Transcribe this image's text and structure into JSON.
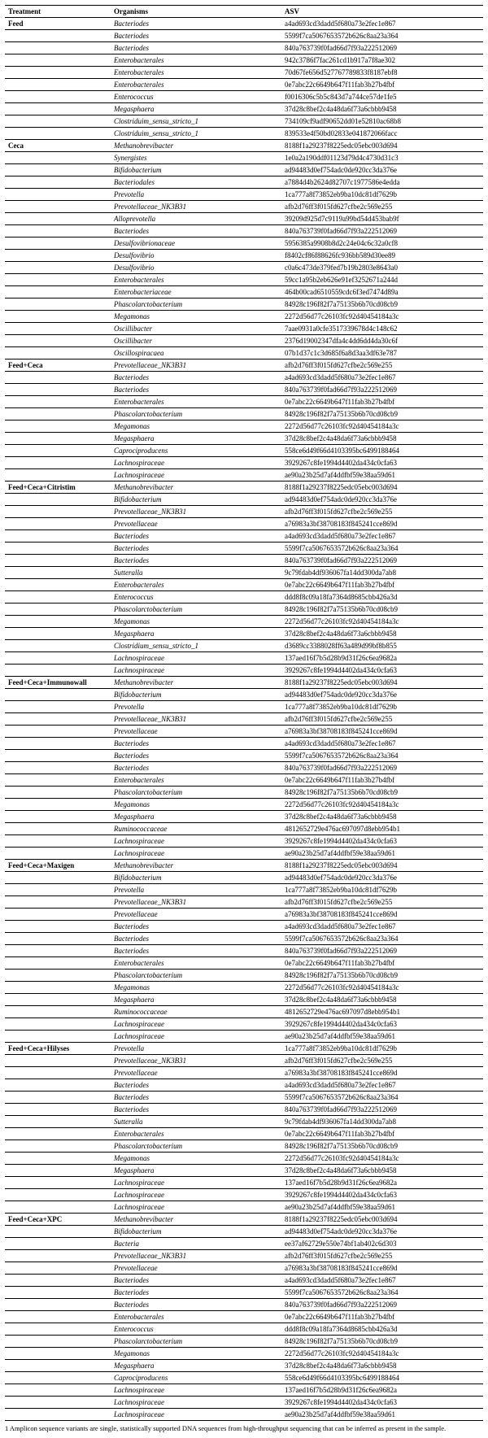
{
  "footnote": "1 Amplicon sequence variants are single, statistically supported DNA sequences from high-throughput sequencing that can be inferred as present in the sample.",
  "columns": [
    "Treatment",
    "Organisms",
    "ASV"
  ],
  "groups": [
    {
      "treatment": "Feed",
      "rows": [
        {
          "organism": "Bacteriodes",
          "asv": "a4ad693cd3dadd5f680a73e2fec1e867"
        },
        {
          "organism": "Bacteriodes",
          "asv": "5599f7ca5067653572b626c8aa23a364"
        },
        {
          "organism": "Bacteriodes",
          "asv": "840a763739f0fad66d7f93a222512069"
        },
        {
          "organism": "Enterobacterales",
          "asv": "942c3786f7fac261cd1b917a7f8ae302"
        },
        {
          "organism": "Enterobacterales",
          "asv": "70d67fe656d527767789833f8187ebf8"
        },
        {
          "organism": "Enterobacterales",
          "asv": "0e7abc22c6649b647f11fab3b27b4fbf"
        },
        {
          "organism": "Enterococcus",
          "asv": "f0016306c5b5c843d7a744ce57de1fe5"
        },
        {
          "organism": "Megasphaera",
          "asv": "37d28c8bef2c4a48da6f73a6cbbb9458"
        },
        {
          "organism": "Clostriduim_sensu_stricto_1",
          "asv": "734109cf9adf90652dd01e52810ac68b8"
        },
        {
          "organism": "Clostriduim_sensu_stricto_1",
          "asv": "839533e4f50bd02833e041872066facc"
        }
      ]
    },
    {
      "treatment": "Ceca",
      "rows": [
        {
          "organism": "Methanobrevibacter",
          "asv": "8188f1a29237f8225edc05ebc003d694"
        },
        {
          "organism": "Synergistes",
          "asv": "1e0a2a190ddf01123d79d4c4730d31c3"
        },
        {
          "organism": "Bifidobacterium",
          "asv": "ad94483d0ef754adc0de920cc3da376e"
        },
        {
          "organism": "Bacteriodales",
          "asv": "a7884d4b2624d82707c1977586e4edda"
        },
        {
          "organism": "Prevotella",
          "asv": "1ca777a8f73852eb9ba10dc81df7629b"
        },
        {
          "organism": "Prevotellaceae_NK3B31",
          "asv": "afb2d76ff3f015fd627cfbe2c569e255"
        },
        {
          "organism": "Alloprevotella",
          "asv": "39209d925d7c9119a99bd54d453bab9f"
        },
        {
          "organism": "Bacteriodes",
          "asv": "840a763739f0fad66d7f93a222512069"
        },
        {
          "organism": "Desulfovibrionaceae",
          "asv": "5956385a9908b8d2c24e04c6c32a0cf8"
        },
        {
          "organism": "Desulfovibrio",
          "asv": "f8402cf86f88626fc936bb589d30ee89"
        },
        {
          "organism": "Desulfovibrio",
          "asv": "c0a6c473de379fed7b19b2803e8643a0"
        },
        {
          "organism": "Enterobacterales",
          "asv": "59cc1a95b2eb626e91ef3252671a244d"
        },
        {
          "organism": "Enterobacteriaceae",
          "asv": "464b00cad6510559cdc6f3ed7474d89a"
        },
        {
          "organism": "Phascolarctobacterium",
          "asv": "84928c196f82f7a75135b6b70cd08cb9"
        },
        {
          "organism": "Megamonas",
          "asv": "2272d56d77c26103fc92d40454184a3c"
        },
        {
          "organism": "Oscillibacter",
          "asv": "7aae0931a0cfe3517339678d4c148c62"
        },
        {
          "organism": "Oscillibacter",
          "asv": "2376d19002347dfa4c4dd6dd4da30c6f"
        },
        {
          "organism": "Oscillospiracaea",
          "asv": "07b1d37c1c3d685f6a8d3aa3df63e787"
        }
      ]
    },
    {
      "treatment": "Feed+Ceca",
      "rows": [
        {
          "organism": "Prevotellaceae_NK3B31",
          "asv": "afb2d76ff3f015fd627cfbe2c569e255"
        },
        {
          "organism": "Bacteriodes",
          "asv": "a4ad693cd3dadd5f680a73e2fec1e867"
        },
        {
          "organism": "Bacteriodes",
          "asv": "840a763739f0fad66d7f93a222512069"
        },
        {
          "organism": "Enterobacterales",
          "asv": "0e7abc22c6649b647f11fab3b27b4fbf"
        },
        {
          "organism": "Phascolarctobacterium",
          "asv": "84928c196f82f7a75135b6b70cd08cb9"
        },
        {
          "organism": "Megamonas",
          "asv": "2272d56d77c26103fc92d40454184a3c"
        },
        {
          "organism": "Megasphaera",
          "asv": "37d28c8bef2c4a48da6f73a6cbbb9458"
        },
        {
          "organism": "Caprociproducens",
          "asv": "558ce6d49f66d4103395bc6499188464"
        },
        {
          "organism": "Lachnospiraceae",
          "asv": "3929267c8fe1994d4402da434c0cfa63"
        },
        {
          "organism": "Lachnospiraceae",
          "asv": "ae90a23b25d7af4ddfbf59e38aa59d61"
        }
      ]
    },
    {
      "treatment": "Feed+Ceca+Citristim",
      "rows": [
        {
          "organism": "Methanobrevibacter",
          "asv": "8188f1a29237f8225edc05ebc003d694"
        },
        {
          "organism": "Bifidobacterium",
          "asv": "ad94483d0ef754adc0de920cc3da376e"
        },
        {
          "organism": "Prevotellaceae_NK3B31",
          "asv": "afb2d76ff3f015fd627cfbe2c569e255"
        },
        {
          "organism": "Prevotellaceae",
          "asv": "a76983a3bf38708183f845241cce869d"
        },
        {
          "organism": "Bacteriodes",
          "asv": "a4ad693cd3dadd5f680a73e2fec1e867"
        },
        {
          "organism": "Bacteriodes",
          "asv": "5599f7ca5067653572b626c8aa23a364"
        },
        {
          "organism": "Bacteriodes",
          "asv": "840a763739f0fad66d7f93a222512069"
        },
        {
          "organism": "Sutteralla",
          "asv": "9c79fdab4df936067fa14dd300da7ab8"
        },
        {
          "organism": "Enterobacterales",
          "asv": "0e7abc22c6649b647f11fab3b27b4fbf"
        },
        {
          "organism": "Enterococcus",
          "asv": "ddd8f8c09a18fa7364d8685cbb426a3d"
        },
        {
          "organism": "Phascolarctobacterium",
          "asv": "84928c196f82f7a75135b6b70cd08cb9"
        },
        {
          "organism": "Megamonas",
          "asv": "2272d56d77c26103fc92d40454184a3c"
        },
        {
          "organism": "Megasphaera",
          "asv": "37d28c8bef2c4a48da6f73a6cbbb9458"
        },
        {
          "organism": "Clostridium_sensu_stricto_1",
          "asv": "d3689cc3388028ff63a489d99bf8b855"
        },
        {
          "organism": "Lachnospiraceae",
          "asv": "137aed16f7b5d28b9d31f26c6ea9682a"
        },
        {
          "organism": "Lachnospiraceae",
          "asv": "3929267c8fe1994d4402da434c0cfa63"
        }
      ]
    },
    {
      "treatment": "Feed+Ceca+Immunowall",
      "rows": [
        {
          "organism": "Methanobrevibacter",
          "asv": "8188f1a29237f8225edc05ebc003d694"
        },
        {
          "organism": "Bifidobacterium",
          "asv": "ad94483d0ef754adc0de920cc3da376e"
        },
        {
          "organism": "Prevotella",
          "asv": "1ca777a8f73852eb9ba10dc81df7629b"
        },
        {
          "organism": "Prevotellaceae_NK3B31",
          "asv": "afb2d76ff3f015fd627cfbe2c569e255"
        },
        {
          "organism": "Prevotellaceae",
          "asv": "a76983a3bf38708183f845241cce869d"
        },
        {
          "organism": "Bacteriodes",
          "asv": "a4ad693cd3dadd5f680a73e2fec1e867"
        },
        {
          "organism": "Bacteriodes",
          "asv": "5599f7ca5067653572b626c8aa23a364"
        },
        {
          "organism": "Bacteriodes",
          "asv": "840a763739f0fad66d7f93a222512069"
        },
        {
          "organism": "Enterobacterales",
          "asv": "0e7abc22c6649b647f11fab3b27b4fbf"
        },
        {
          "organism": "Phascolarctobacterium",
          "asv": "84928c196f82f7a75135b6b70cd08cb9"
        },
        {
          "organism": "Megamonas",
          "asv": "2272d56d77c26103fc92d40454184a3c"
        },
        {
          "organism": "Megasphaera",
          "asv": "37d28c8bef2c4a48da6f73a6cbbb9458"
        },
        {
          "organism": "Ruminococcaceae",
          "asv": "4812652729e476ac697097d8ebb954b1"
        },
        {
          "organism": "Lachnospiraceae",
          "asv": "3929267c8fe1994d4402da434c0cfa63"
        },
        {
          "organism": "Lachnospiraceae",
          "asv": "ae90a23b25d7af4ddfbf59e38aa59d61"
        }
      ]
    },
    {
      "treatment": "Feed+Ceca+Maxigen",
      "rows": [
        {
          "organism": "Methanobrevibacter",
          "asv": "8188f1a29237f8225edc05ebc003d694"
        },
        {
          "organism": "Bifidobacterium",
          "asv": "ad94483d0ef754adc0de920cc3da376e"
        },
        {
          "organism": "Prevotella",
          "asv": "1ca777a8f73852eb9ba10dc81df7629b"
        },
        {
          "organism": "Prevotellaceae_NK3B31",
          "asv": "afb2d76ff3f015fd627cfbe2c569e255"
        },
        {
          "organism": "Prevotellaceae",
          "asv": "a76983a3bf38708183f845241cce869d"
        },
        {
          "organism": "Bacteriodes",
          "asv": "a4ad693cd3dadd5f680a73e2fec1e867"
        },
        {
          "organism": "Bacteriodes",
          "asv": "5599f7ca5067653572b626c8aa23a364"
        },
        {
          "organism": "Bacteriodes",
          "asv": "840a763739f0fad66d7f93a222512069"
        },
        {
          "organism": "Enterobacterales",
          "asv": "0e7abc22c6649b647f11fab3b27b4fbf"
        },
        {
          "organism": "Phascolarctobacterium",
          "asv": "84928c196f82f7a75135b6b70cd08cb9"
        },
        {
          "organism": "Megamonas",
          "asv": "2272d56d77c26103fc92d40454184a3c"
        },
        {
          "organism": "Megasphaera",
          "asv": "37d28c8bef2c4a48da6f73a6cbbb9458"
        },
        {
          "organism": "Ruminococcaceae",
          "asv": "4812652729e476ac697097d8ebb954b1"
        },
        {
          "organism": "Lachnospiraceae",
          "asv": "3929267c8fe1994d4402da434c0cfa63"
        },
        {
          "organism": "Lachnospiraceae",
          "asv": "ae90a23b25d7af4ddfbf59e38aa59d61"
        }
      ]
    },
    {
      "treatment": "Feed+Ceca+Hilyses",
      "rows": [
        {
          "organism": "Prevotella",
          "asv": "1ca777a8f73852eb9ba10dc81df7629b"
        },
        {
          "organism": "Prevotellaceae_NK3B31",
          "asv": "afb2d76ff3f015fd627cfbe2c569e255"
        },
        {
          "organism": "Prevotellaceae",
          "asv": "a76983a3bf38708183f845241cce869d"
        },
        {
          "organism": "Bacteriodes",
          "asv": "a4ad693cd3dadd5f680a73e2fec1e867"
        },
        {
          "organism": "Bacteriodes",
          "asv": "5599f7ca5067653572b626c8aa23a364"
        },
        {
          "organism": "Bacteriodes",
          "asv": "840a763739f0fad66d7f93a222512069"
        },
        {
          "organism": "Sutteralla",
          "asv": "9c79fdab4df936067fa14dd300da7ab8"
        },
        {
          "organism": "Enterobacterales",
          "asv": "0e7abc22c6649b647f11fab3b27b4fbf"
        },
        {
          "organism": "Phascolarctobacterium",
          "asv": "84928c196f82f7a75135b6b70cd08cb9"
        },
        {
          "organism": "Megamonas",
          "asv": "2272d56d77c26103fc92d40454184a3c"
        },
        {
          "organism": "Megasphaera",
          "asv": "37d28c8bef2c4a48da6f73a6cbbb9458"
        },
        {
          "organism": "Lachnospiraceae",
          "asv": "137aed16f7b5d28b9d31f26c6ea9682a"
        },
        {
          "organism": "Lachnospiraceae",
          "asv": "3929267c8fe1994d4402da434c0cfa63"
        },
        {
          "organism": "Lachnospiraceae",
          "asv": "ae90a23b25d7af4ddfbf59e38aa59d61"
        }
      ]
    },
    {
      "treatment": "Feed+Ceca+XPC",
      "rows": [
        {
          "organism": "Methanobrevibacter",
          "asv": "8188f1a29237f8225edc05ebc003d694"
        },
        {
          "organism": "Bifidobacterium",
          "asv": "ad94483d0ef754adc0de920cc3da376e"
        },
        {
          "organism": "Bacteria",
          "asv": "ee37af62729e550e74bf1ab402c6d303"
        },
        {
          "organism": "Prevotellaceae_NK3B31",
          "asv": "afb2d76ff3f015fd627cfbe2c569e255"
        },
        {
          "organism": "Prevotellaceae",
          "asv": "a76983a3bf38708183f845241cce869d"
        },
        {
          "organism": "Bacteriodes",
          "asv": "a4ad693cd3dadd5f680a73e2fec1e867"
        },
        {
          "organism": "Bacteriodes",
          "asv": "5599f7ca5067653572b626c8aa23a364"
        },
        {
          "organism": "Bacteriodes",
          "asv": "840a763739f0fad66d7f93a222512069"
        },
        {
          "organism": "Enterobacterales",
          "asv": "0e7abc22c6649b647f11fab3b27b4fbf"
        },
        {
          "organism": "Enterococcus",
          "asv": "ddd8f8c09a18fa7364d8685cbb426a3d"
        },
        {
          "organism": "Phascolarctobacterium",
          "asv": "84928c196f82f7a75135b6b70cd08cb9"
        },
        {
          "organism": "Megamonas",
          "asv": "2272d56d77c26103fc92d40454184a3c"
        },
        {
          "organism": "Megasphaera",
          "asv": "37d28c8bef2c4a48da6f73a6cbbb9458"
        },
        {
          "organism": "Caprociproducens",
          "asv": "558ce6d49f66d4103395bc6499188464"
        },
        {
          "organism": "Lachnospiraceae",
          "asv": "137aed16f7b5d28b9d31f26c6ea9682a"
        },
        {
          "organism": "Lachnospiraceae",
          "asv": "3929267c8fe1994d4402da434c0cfa63"
        },
        {
          "organism": "Lachnospiraceae",
          "asv": "ae90a23b25d7af4ddfbf59e38aa59d61"
        }
      ]
    }
  ]
}
